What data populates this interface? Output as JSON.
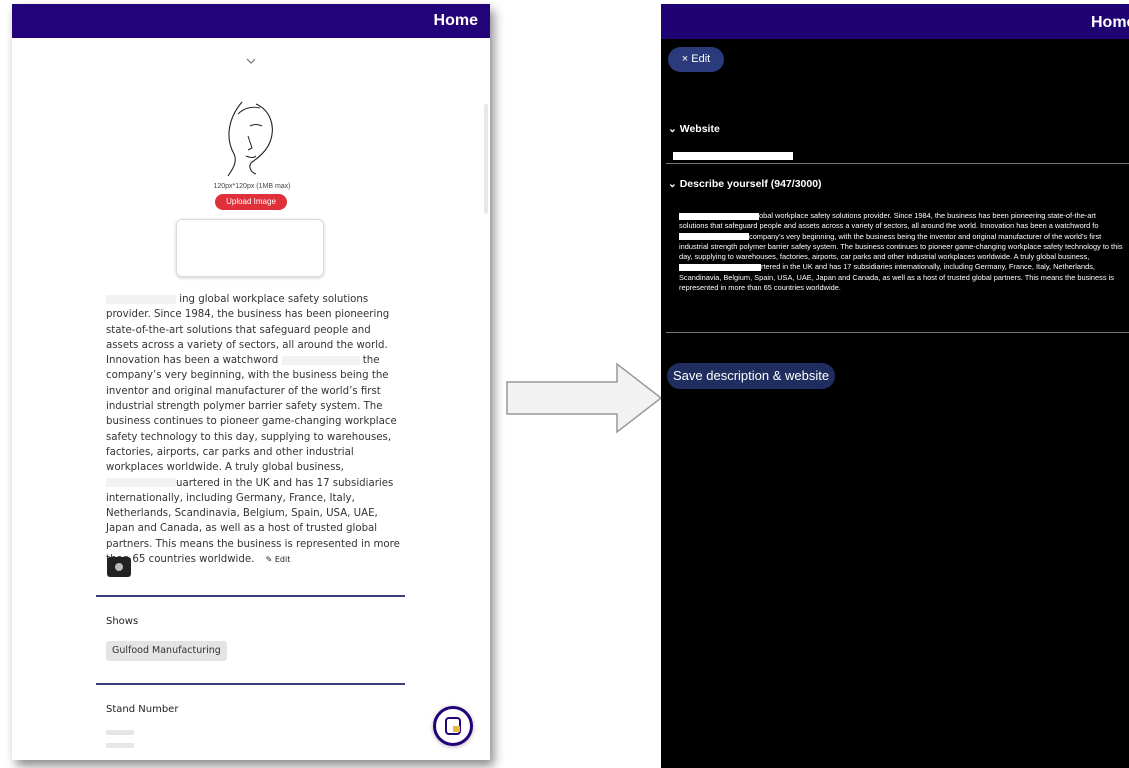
{
  "left": {
    "header_title": "Home",
    "image_size_hint": "120px*120px (1MB max)",
    "upload_label": "Upload Image",
    "description_parts": [
      "ing global workplace safety solutions provider. Since 1984, the business has been pioneering state-of-the-art solutions that safeguard people and assets across a variety of sectors, all around the world. Innovation has been a watchword ",
      " the company’s very beginning, with the business being the inventor and original manufacturer of the world’s first industrial strength polymer barrier safety system. The business continues to pioneer game-changing workplace safety technology to this day, supplying to warehouses, factories, airports, car parks and other industrial workplaces worldwide. A truly global business, ",
      "uartered in the UK and has 17 subsidiaries internationally, including Germany, France, Italy, Netherlands, Scandinavia, Belgium, Spain, USA, UAE, Japan and Canada, as well as a host of trusted global partners. This means the business is represented in more than 65 countries worldwide."
    ],
    "edit_label": "✎ Edit",
    "shows_label": "Shows",
    "show_chip": "Gulfood Manufacturing",
    "stand_label": "Stand Number"
  },
  "right": {
    "header_title": "Home",
    "edit_button": "× Edit",
    "website_label": "Website",
    "describe_label": "Describe yourself (947/3000)",
    "description_parts": [
      "obal workplace safety solutions provider. Since 1984, the business has been pioneering state-of-the-art solutions that safeguard people and assets across a variety of sectors, all around the world. Innovation has been a watchword fo",
      "company’s very beginning, with the business being the inventor and original manufacturer of the world’s first industrial strength polymer barrier safety system. The business continues to pioneer game-changing workplace safety technology to this day, supplying to warehouses, factories, airports, car parks and other industrial workplaces worldwide. A truly global business, ",
      "rtered in the UK and has 17 subsidiaries internationally, including Germany, France, Italy, Netherlands, Scandinavia, Belgium, Spain, USA, UAE, Japan and Canada, as well as a host of trusted global partners. This means the business is represented in more than 65 countries worldwide."
    ],
    "save_button": "Save description & website"
  },
  "colors": {
    "header_purple": "#22037a",
    "upload_red": "#e0303a",
    "rule_navy": "#3a3f7a",
    "button_navy": "#1f2e5e"
  },
  "icons": [
    "chevron-down-icon",
    "face-line-art-image",
    "camera-icon",
    "pencil-icon",
    "app-logo-icon",
    "arrow-right-icon"
  ]
}
